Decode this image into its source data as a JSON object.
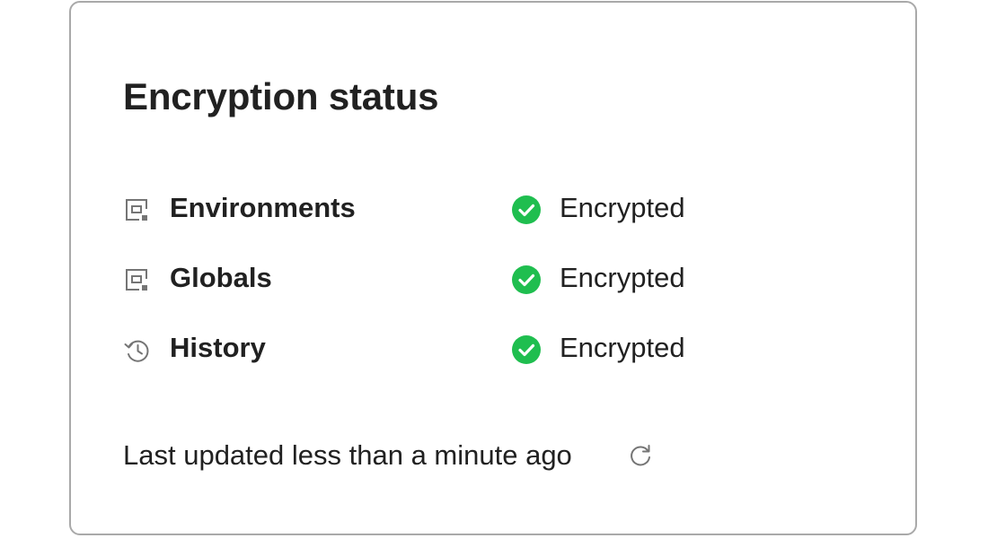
{
  "card": {
    "title": "Encryption status",
    "items": [
      {
        "label": "Environments",
        "icon": "environment-box-icon",
        "status": "Encrypted",
        "status_icon": "check-circle-icon"
      },
      {
        "label": "Globals",
        "icon": "environment-box-icon",
        "status": "Encrypted",
        "status_icon": "check-circle-icon"
      },
      {
        "label": "History",
        "icon": "history-icon",
        "status": "Encrypted",
        "status_icon": "check-circle-icon"
      }
    ],
    "footer": {
      "text": "Last updated less than a minute ago",
      "refresh_icon": "refresh-icon"
    }
  },
  "colors": {
    "success": "#1fbe4f",
    "icon_gray": "#757575",
    "text": "#212121",
    "border": "#a9a9a9"
  }
}
